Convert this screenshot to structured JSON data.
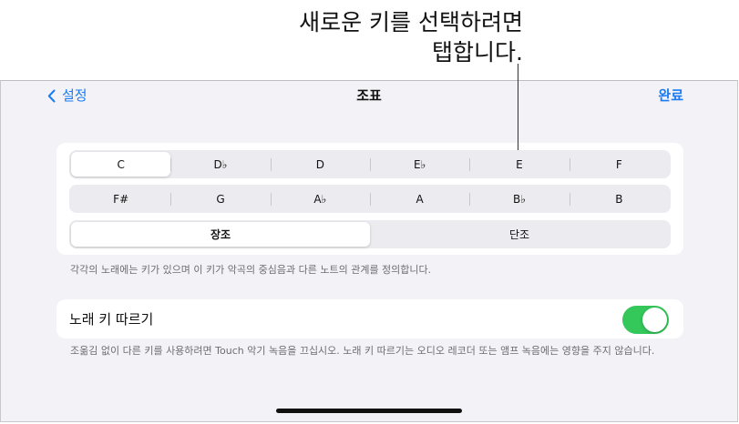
{
  "callout": {
    "line1": "새로운 키를 선택하려면",
    "line2": "탭합니다."
  },
  "nav": {
    "back_label": "설정",
    "title": "조표",
    "done_label": "완료"
  },
  "keys_row1": [
    {
      "label": "C",
      "selected": true
    },
    {
      "label": "D♭",
      "selected": false
    },
    {
      "label": "D",
      "selected": false
    },
    {
      "label": "E♭",
      "selected": false
    },
    {
      "label": "E",
      "selected": false
    },
    {
      "label": "F",
      "selected": false
    }
  ],
  "keys_row2": [
    {
      "label": "F#",
      "selected": false
    },
    {
      "label": "G",
      "selected": false
    },
    {
      "label": "A♭",
      "selected": false
    },
    {
      "label": "A",
      "selected": false
    },
    {
      "label": "B♭",
      "selected": false
    },
    {
      "label": "B",
      "selected": false
    }
  ],
  "mode": {
    "major_label": "장조",
    "minor_label": "단조",
    "selected": "major"
  },
  "key_caption": "각각의 노래에는 키가 있으며 이 키가 악곡의 중심음과 다른 노트의 관계를 정의합니다.",
  "follow_key": {
    "label": "노래 키 따르기",
    "enabled": true
  },
  "follow_caption": "조옮김 없이 다른 키를 사용하려면 Touch 악기 녹음을 끄십시오. 노래 키 따르기는 오디오 레코더 또는 앰프 녹음에는 영향을 주지 않습니다.",
  "colors": {
    "accent": "#1a7cf2",
    "switch_on": "#34c759",
    "background": "#f2f2f7"
  }
}
